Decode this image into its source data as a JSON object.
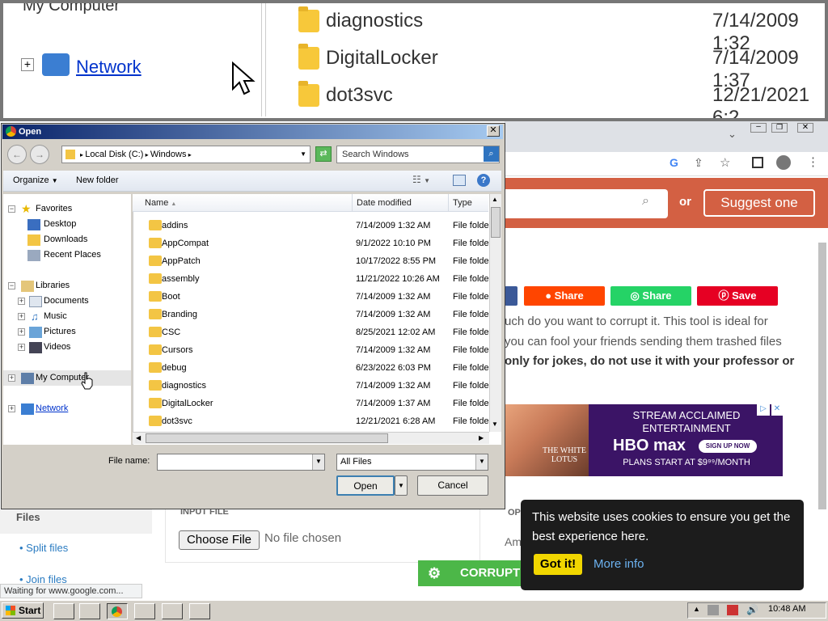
{
  "zoom": {
    "tree": {
      "my_computer": "My Computer",
      "network": "Network"
    },
    "rows": [
      {
        "name": "diagnostics",
        "date": "7/14/2009 1:32"
      },
      {
        "name": "DigitalLocker",
        "date": "7/14/2009 1:37"
      },
      {
        "name": "dot3svc",
        "date": "12/21/2021 6:2"
      }
    ]
  },
  "browser": {
    "search_or": "or",
    "suggest_label": "Suggest one",
    "share_buttons": [
      {
        "label": "Share",
        "color": "#ff4500"
      },
      {
        "label": "Share",
        "color": "#25d366"
      },
      {
        "label": "Save",
        "color": "#e60023"
      }
    ],
    "paragraph": {
      "line1": "uch do you want to corrupt it. This tool is ideal for",
      "line2": "you can fool your friends sending them trashed files",
      "line3": "only for jokes, do not use it with your professor or"
    },
    "ad": {
      "line1": "STREAM ACCLAIMED",
      "line2": "ENTERTAINMENT",
      "brand": "HBO max",
      "cta": "SIGN UP NOW",
      "line3": "PLANS START AT $9⁹⁹/MONTH",
      "image_text": "THE WHITE LOTUS"
    },
    "sidebar": {
      "heading": "Files",
      "links": [
        "Split files",
        "Join files"
      ]
    },
    "input_file_label": "INPUT FILE",
    "choose_file": "Choose File",
    "no_file": "No file chosen",
    "options_label": "OPT",
    "amount_label": "Amo",
    "corrupt_label": "CORRUPT",
    "cookie": {
      "text": "This website uses cookies to ensure you get the best experience here.",
      "got_it": "Got it!",
      "more_info": "More info"
    },
    "status": "Waiting for www.google.com..."
  },
  "dialog": {
    "title": "Open",
    "path": [
      "Local Disk (C:)",
      "Windows"
    ],
    "search_placeholder": "Search Windows",
    "toolbar": {
      "organize": "Organize",
      "new_folder": "New folder"
    },
    "tree": {
      "favorites": "Favorites",
      "fav_items": [
        "Desktop",
        "Downloads",
        "Recent Places"
      ],
      "libraries": "Libraries",
      "lib_items": [
        "Documents",
        "Music",
        "Pictures",
        "Videos"
      ],
      "my_computer": "My Computer",
      "network": "Network"
    },
    "columns": [
      "Name",
      "Date modified",
      "Type"
    ],
    "files": [
      {
        "name": "addins",
        "date": "7/14/2009 1:32 AM",
        "type": "File folder"
      },
      {
        "name": "AppCompat",
        "date": "9/1/2022 10:10 PM",
        "type": "File folder"
      },
      {
        "name": "AppPatch",
        "date": "10/17/2022 8:55 PM",
        "type": "File folder"
      },
      {
        "name": "assembly",
        "date": "11/21/2022 10:26 AM",
        "type": "File folder"
      },
      {
        "name": "Boot",
        "date": "7/14/2009 1:32 AM",
        "type": "File folder"
      },
      {
        "name": "Branding",
        "date": "7/14/2009 1:32 AM",
        "type": "File folder"
      },
      {
        "name": "CSC",
        "date": "8/25/2021 12:02 AM",
        "type": "File folder"
      },
      {
        "name": "Cursors",
        "date": "7/14/2009 1:32 AM",
        "type": "File folder"
      },
      {
        "name": "debug",
        "date": "6/23/2022 6:03 PM",
        "type": "File folder"
      },
      {
        "name": "diagnostics",
        "date": "7/14/2009 1:32 AM",
        "type": "File folder"
      },
      {
        "name": "DigitalLocker",
        "date": "7/14/2009 1:37 AM",
        "type": "File folder"
      },
      {
        "name": "dot3svc",
        "date": "12/21/2021 6:28 AM",
        "type": "File folder"
      }
    ],
    "file_name_label": "File name:",
    "file_name_value": "",
    "file_type": "All Files",
    "open_label": "Open",
    "cancel_label": "Cancel"
  },
  "taskbar": {
    "start": "Start",
    "clock": "10:48 AM"
  }
}
